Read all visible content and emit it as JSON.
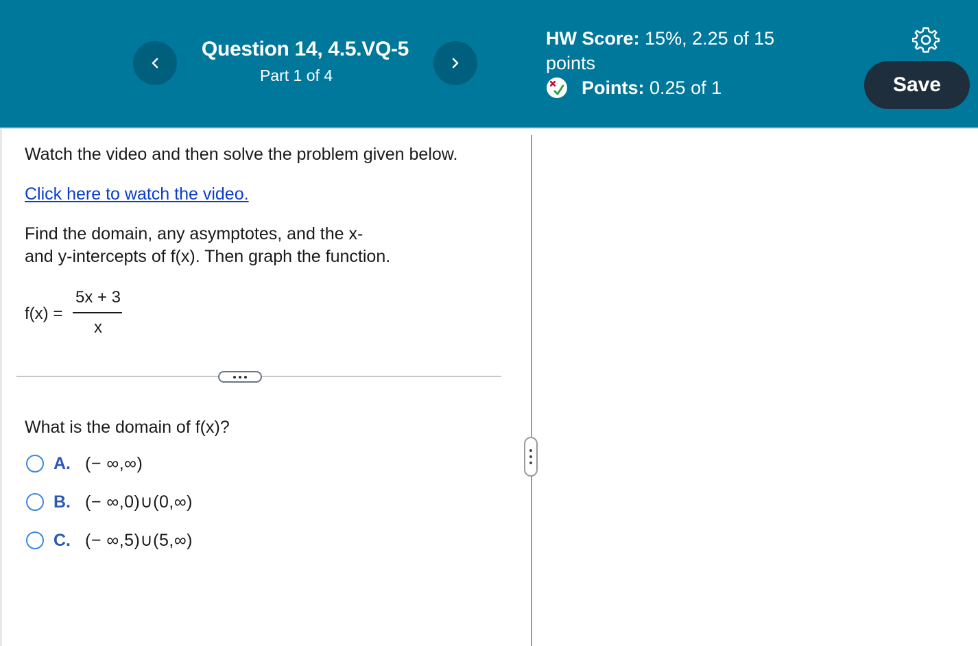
{
  "header": {
    "question_title": "Question 14, 4.5.VQ-5",
    "part": "Part 1 of 4",
    "hw_score_label": "HW Score:",
    "hw_score_value": "15%, 2.25 of 15",
    "hw_score_unit": "points",
    "points_label": "Points:",
    "points_value": "0.25 of 1",
    "save_label": "Save",
    "prev_icon": "chevron-left-icon",
    "next_icon": "chevron-right-icon",
    "settings_icon": "gear-icon",
    "colors": {
      "header_bg": "#00789b",
      "nav_btn_bg": "#005f7d",
      "save_bg": "#1f2e3d"
    }
  },
  "question": {
    "instruction": "Watch the video and then solve the problem given below.",
    "video_link": "Click here to watch the video.",
    "prompt_line1": "Find the domain, any asymptotes, and the x-",
    "prompt_line2": "and y-intercepts of f(x). Then graph the function.",
    "function_lhs": "f(x) =",
    "numerator": "5x + 3",
    "denominator": "x"
  },
  "part1": {
    "question": "What is the domain of f(x)?",
    "options": [
      {
        "letter": "A.",
        "text": "(− ∞,∞)"
      },
      {
        "letter": "B.",
        "text": "(− ∞,0)∪(0,∞)"
      },
      {
        "letter": "C.",
        "text": "(− ∞,5)∪(5,∞)"
      }
    ]
  }
}
